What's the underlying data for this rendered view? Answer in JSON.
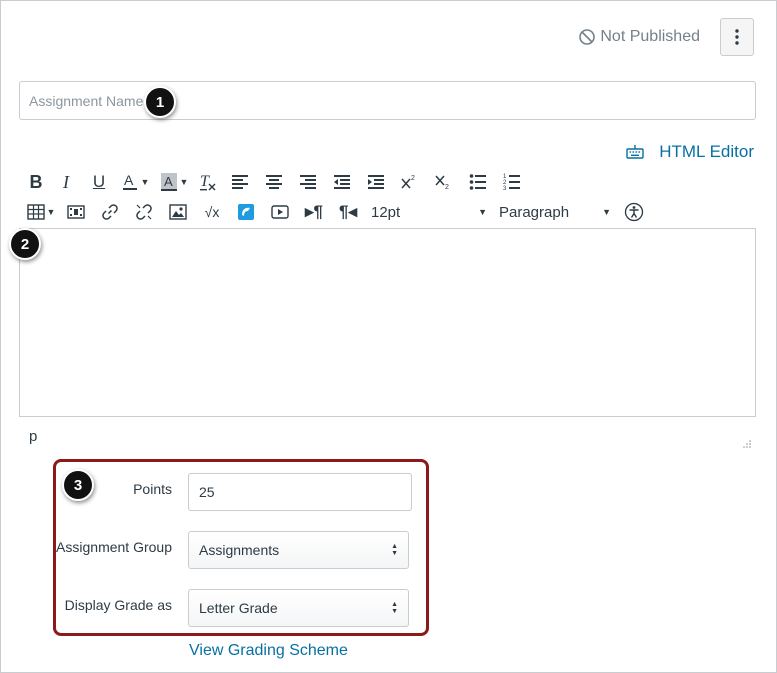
{
  "header": {
    "status_label": "Not Published",
    "status_icon": "not-published-icon",
    "menu_icon": "kebab-menu-icon"
  },
  "assignment_name": {
    "placeholder": "Assignment Name",
    "value": ""
  },
  "callouts": [
    "1",
    "2",
    "3"
  ],
  "editor": {
    "html_editor_label": "HTML Editor",
    "font_size": "12pt",
    "block_format": "Paragraph",
    "path": "p"
  },
  "form": {
    "points_label": "Points",
    "points_value": "25",
    "group_label": "Assignment Group",
    "group_value": "Assignments",
    "display_label": "Display Grade as",
    "display_value": "Letter Grade",
    "scheme_link": "View Grading Scheme"
  },
  "colors": {
    "link": "#0770a3",
    "highlight": "#8b1a1a",
    "border": "#c7cdd1"
  }
}
